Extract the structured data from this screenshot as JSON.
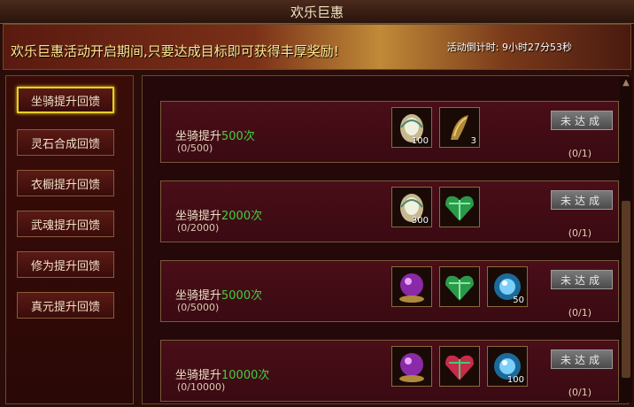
{
  "window": {
    "title": "欢乐巨惠"
  },
  "banner": {
    "message": "欢乐巨惠活动开启期间,只要达成目标即可获得丰厚奖励!",
    "countdown": "活动倒计时: 9小时27分53秒"
  },
  "sidebar": {
    "items": [
      {
        "label": "坐骑提升回馈",
        "active": true
      },
      {
        "label": "灵石合成回馈",
        "active": false
      },
      {
        "label": "衣橱提升回馈",
        "active": false
      },
      {
        "label": "武魂提升回馈",
        "active": false
      },
      {
        "label": "修为提升回馈",
        "active": false
      },
      {
        "label": "真元提升回馈",
        "active": false
      }
    ]
  },
  "rewards": {
    "rows": [
      {
        "prefix": "坐骑提升",
        "target": "500次",
        "progress": "(0/500)",
        "button": "未达成",
        "count": "(0/1)",
        "items": [
          {
            "icon": "egg-icon",
            "qty": "100"
          },
          {
            "icon": "horn-icon",
            "qty": "3"
          }
        ]
      },
      {
        "prefix": "坐骑提升",
        "target": "2000次",
        "progress": "(0/2000)",
        "button": "未达成",
        "count": "(0/1)",
        "items": [
          {
            "icon": "egg-icon",
            "qty": "300"
          },
          {
            "icon": "green-gift-icon",
            "qty": ""
          }
        ]
      },
      {
        "prefix": "坐骑提升",
        "target": "5000次",
        "progress": "(0/5000)",
        "button": "未达成",
        "count": "(0/1)",
        "items": [
          {
            "icon": "purple-orb-icon",
            "qty": ""
          },
          {
            "icon": "green-gift-icon",
            "qty": ""
          },
          {
            "icon": "blue-orb-icon",
            "qty": "50"
          }
        ]
      },
      {
        "prefix": "坐骑提升",
        "target": "10000次",
        "progress": "(0/10000)",
        "button": "未达成",
        "count": "(0/1)",
        "items": [
          {
            "icon": "purple-orb-icon",
            "qty": ""
          },
          {
            "icon": "red-gift-icon",
            "qty": ""
          },
          {
            "icon": "blue-orb-icon",
            "qty": "100"
          }
        ]
      }
    ]
  }
}
